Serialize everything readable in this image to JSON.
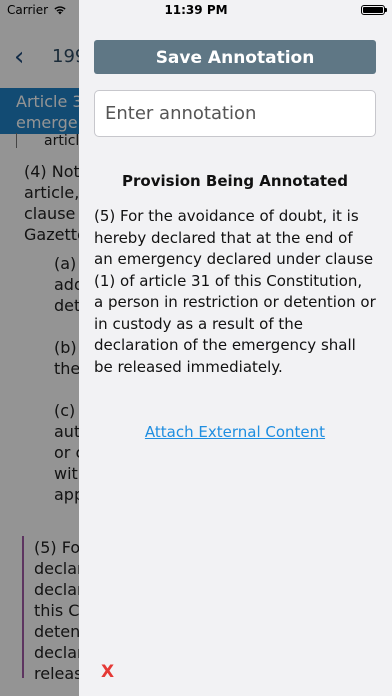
{
  "status_bar": {
    "carrier": "Carrier",
    "time": "11:39 PM",
    "icons": [
      "wifi-icon",
      "battery-icon"
    ]
  },
  "background": {
    "nav_title": "199",
    "article_header_line1": "Article 3",
    "article_header_line2": "emerge",
    "article_sub": "articl",
    "text_lines": [
      "(4) Not",
      "article,",
      "clause",
      "Gazette",
      "(a)",
      "add",
      "det",
      "(b)",
      "the",
      "(c)",
      "aut",
      "or c",
      "wit",
      "app",
      "(5) Fo",
      "declar",
      "declar",
      "this C",
      "deten",
      "declar",
      "releas"
    ]
  },
  "panel": {
    "save_label": "Save Annotation",
    "input_placeholder": "Enter annotation",
    "heading": "Provision Being Annotated",
    "provision_text": "(5) For the avoidance of doubt, it is hereby declared that at the end of an emergency declared under clause (1) of article 31 of this Constitution, a person in restriction or detention or in custody as a result of the declaration of the emergency shall be released immediately.",
    "attach_label": "Attach External Content",
    "close_label": "X"
  },
  "colors": {
    "accent_blue": "#1f82c6",
    "save_button": "#5f7785",
    "link": "#1f8ee0",
    "close_red": "#e53935"
  }
}
